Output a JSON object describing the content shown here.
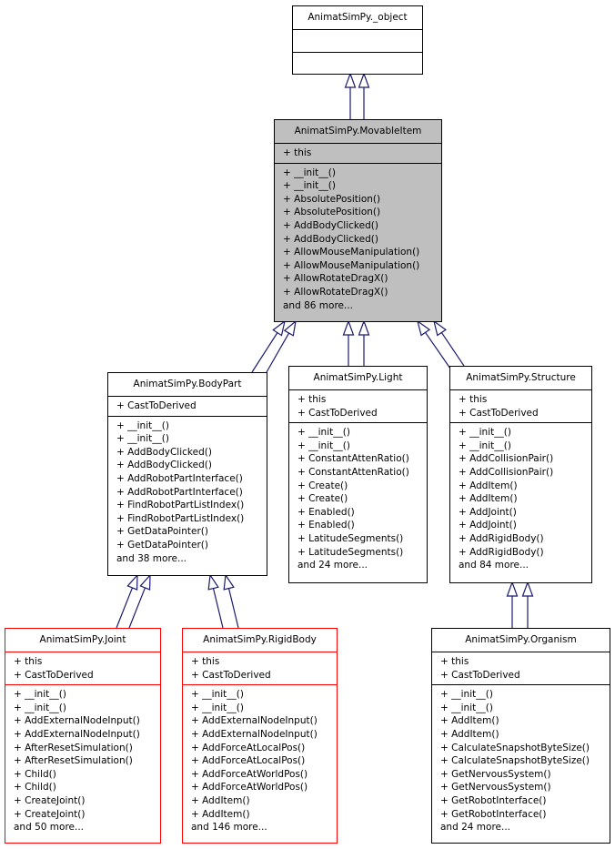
{
  "colors": {
    "edge": "#191970",
    "highlight_fill": "#bfbfbf",
    "incomplete_border": "#ff0000"
  },
  "classes": {
    "object": {
      "name": "AnimatSimPy._object",
      "attributes": [],
      "methods": []
    },
    "movable": {
      "name": "AnimatSimPy.MovableItem",
      "attributes": [
        "+ this"
      ],
      "methods": [
        "+ __init__()",
        "+ __init__()",
        "+ AbsolutePosition()",
        "+ AbsolutePosition()",
        "+ AddBodyClicked()",
        "+ AddBodyClicked()",
        "+ AllowMouseManipulation()",
        "+ AllowMouseManipulation()",
        "+ AllowRotateDragX()",
        "+ AllowRotateDragX()",
        "and 86 more..."
      ]
    },
    "bodypart": {
      "name": "AnimatSimPy.BodyPart",
      "attributes": [
        "+ CastToDerived"
      ],
      "methods": [
        "+ __init__()",
        "+ __init__()",
        "+ AddBodyClicked()",
        "+ AddBodyClicked()",
        "+ AddRobotPartInterface()",
        "+ AddRobotPartInterface()",
        "+ FindRobotPartListIndex()",
        "+ FindRobotPartListIndex()",
        "+ GetDataPointer()",
        "+ GetDataPointer()",
        "and 38 more..."
      ]
    },
    "light": {
      "name": "AnimatSimPy.Light",
      "attributes": [
        "+ this",
        "+ CastToDerived"
      ],
      "methods": [
        "+ __init__()",
        "+ __init__()",
        "+ ConstantAttenRatio()",
        "+ ConstantAttenRatio()",
        "+ Create()",
        "+ Create()",
        "+ Enabled()",
        "+ Enabled()",
        "+ LatitudeSegments()",
        "+ LatitudeSegments()",
        "and 24 more..."
      ]
    },
    "structure": {
      "name": "AnimatSimPy.Structure",
      "attributes": [
        "+ this",
        "+ CastToDerived"
      ],
      "methods": [
        "+ __init__()",
        "+ __init__()",
        "+ AddCollisionPair()",
        "+ AddCollisionPair()",
        "+ AddItem()",
        "+ AddItem()",
        "+ AddJoint()",
        "+ AddJoint()",
        "+ AddRigidBody()",
        "+ AddRigidBody()",
        "and 84 more..."
      ]
    },
    "joint": {
      "name": "AnimatSimPy.Joint",
      "attributes": [
        "+ this",
        "+ CastToDerived"
      ],
      "methods": [
        "+ __init__()",
        "+ __init__()",
        "+ AddExternalNodeInput()",
        "+ AddExternalNodeInput()",
        "+ AfterResetSimulation()",
        "+ AfterResetSimulation()",
        "+ Child()",
        "+ Child()",
        "+ CreateJoint()",
        "+ CreateJoint()",
        "and 50 more..."
      ]
    },
    "rigidbody": {
      "name": "AnimatSimPy.RigidBody",
      "attributes": [
        "+ this",
        "+ CastToDerived"
      ],
      "methods": [
        "+ __init__()",
        "+ __init__()",
        "+ AddExternalNodeInput()",
        "+ AddExternalNodeInput()",
        "+ AddForceAtLocalPos()",
        "+ AddForceAtLocalPos()",
        "+ AddForceAtWorldPos()",
        "+ AddForceAtWorldPos()",
        "+ AddItem()",
        "+ AddItem()",
        "and 146 more..."
      ]
    },
    "organism": {
      "name": "AnimatSimPy.Organism",
      "attributes": [
        "+ this",
        "+ CastToDerived"
      ],
      "methods": [
        "+ __init__()",
        "+ __init__()",
        "+ AddItem()",
        "+ AddItem()",
        "+ CalculateSnapshotByteSize()",
        "+ CalculateSnapshotByteSize()",
        "+ GetNervousSystem()",
        "+ GetNervousSystem()",
        "+ GetRobotInterface()",
        "+ GetRobotInterface()",
        "and 24 more..."
      ]
    }
  }
}
